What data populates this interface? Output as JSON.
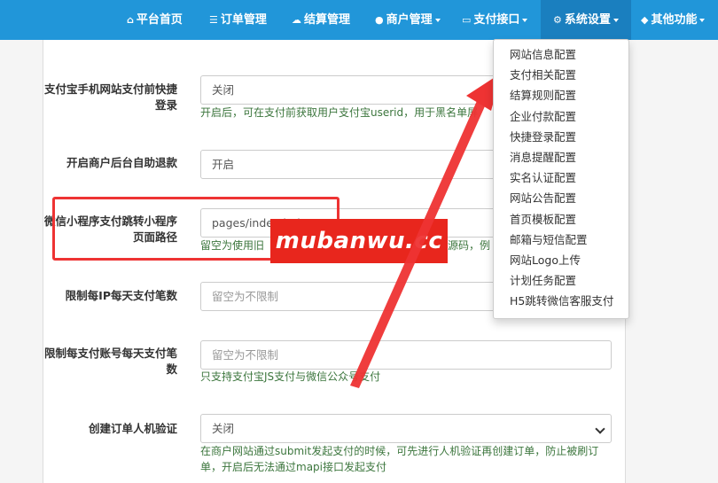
{
  "navbar": {
    "items": [
      {
        "icon": "home-icon",
        "glyph": "⌂",
        "label": "平台首页",
        "caret": false
      },
      {
        "icon": "list-icon",
        "glyph": "☰",
        "label": "订单管理",
        "caret": false
      },
      {
        "icon": "cloud-icon",
        "glyph": "☁",
        "label": "结算管理",
        "caret": false
      },
      {
        "icon": "user-icon",
        "glyph": "●",
        "label": "商户管理",
        "caret": true
      },
      {
        "icon": "credit-card-icon",
        "glyph": "▭",
        "label": "支付接口",
        "caret": true
      },
      {
        "icon": "gear-icon",
        "glyph": "⚙",
        "label": "系统设置",
        "caret": true
      },
      {
        "icon": "cube-icon",
        "glyph": "◆",
        "label": "其他功能",
        "caret": true
      }
    ]
  },
  "form": {
    "partial_help": "...",
    "rows": [
      {
        "label": "支付宝手机网站支付前快捷登录",
        "value": "关闭",
        "help": "开启后，可在支付前获取用户支付宝userid，用于黑名单屏"
      },
      {
        "label": "开启商户后台自助退款",
        "value": "开启",
        "help": ""
      },
      {
        "label": "微信小程序支付跳转小程序页面路径",
        "value": "pages/index/index",
        "help": "留空为使用旧"
      },
      {
        "label": "限制每IP每天支付笔数",
        "placeholder": "留空为不限制",
        "help": ""
      },
      {
        "label": "限制每支付账号每天支付笔数",
        "placeholder": "留空为不限制",
        "help": "只支持支付宝JS支付与微信公众号支付"
      },
      {
        "label": "创建订单人机验证",
        "value": "关闭",
        "help": "在商户网站通过submit发起支付的时候，可先进行人机验证再创建订单，防止被刷订单，开启后无法通过mapi接口发起支付"
      }
    ],
    "help_tail_row3": "源码，例"
  },
  "dropdown": {
    "items": [
      "网站信息配置",
      "支付相关配置",
      "结算规则配置",
      "企业付款配置",
      "快捷登录配置",
      "消息提醒配置",
      "实名认证配置",
      "网站公告配置",
      "首页模板配置",
      "邮箱与短信配置",
      "网站Logo上传",
      "计划任务配置",
      "H5跳转微信客服支付"
    ]
  },
  "watermark": {
    "text": "mubanwu.cc"
  },
  "colors": {
    "navbar": "#2196d9",
    "help_text": "#3c763d",
    "annotation": "#e33",
    "watermark_bg": "#e8261d"
  }
}
